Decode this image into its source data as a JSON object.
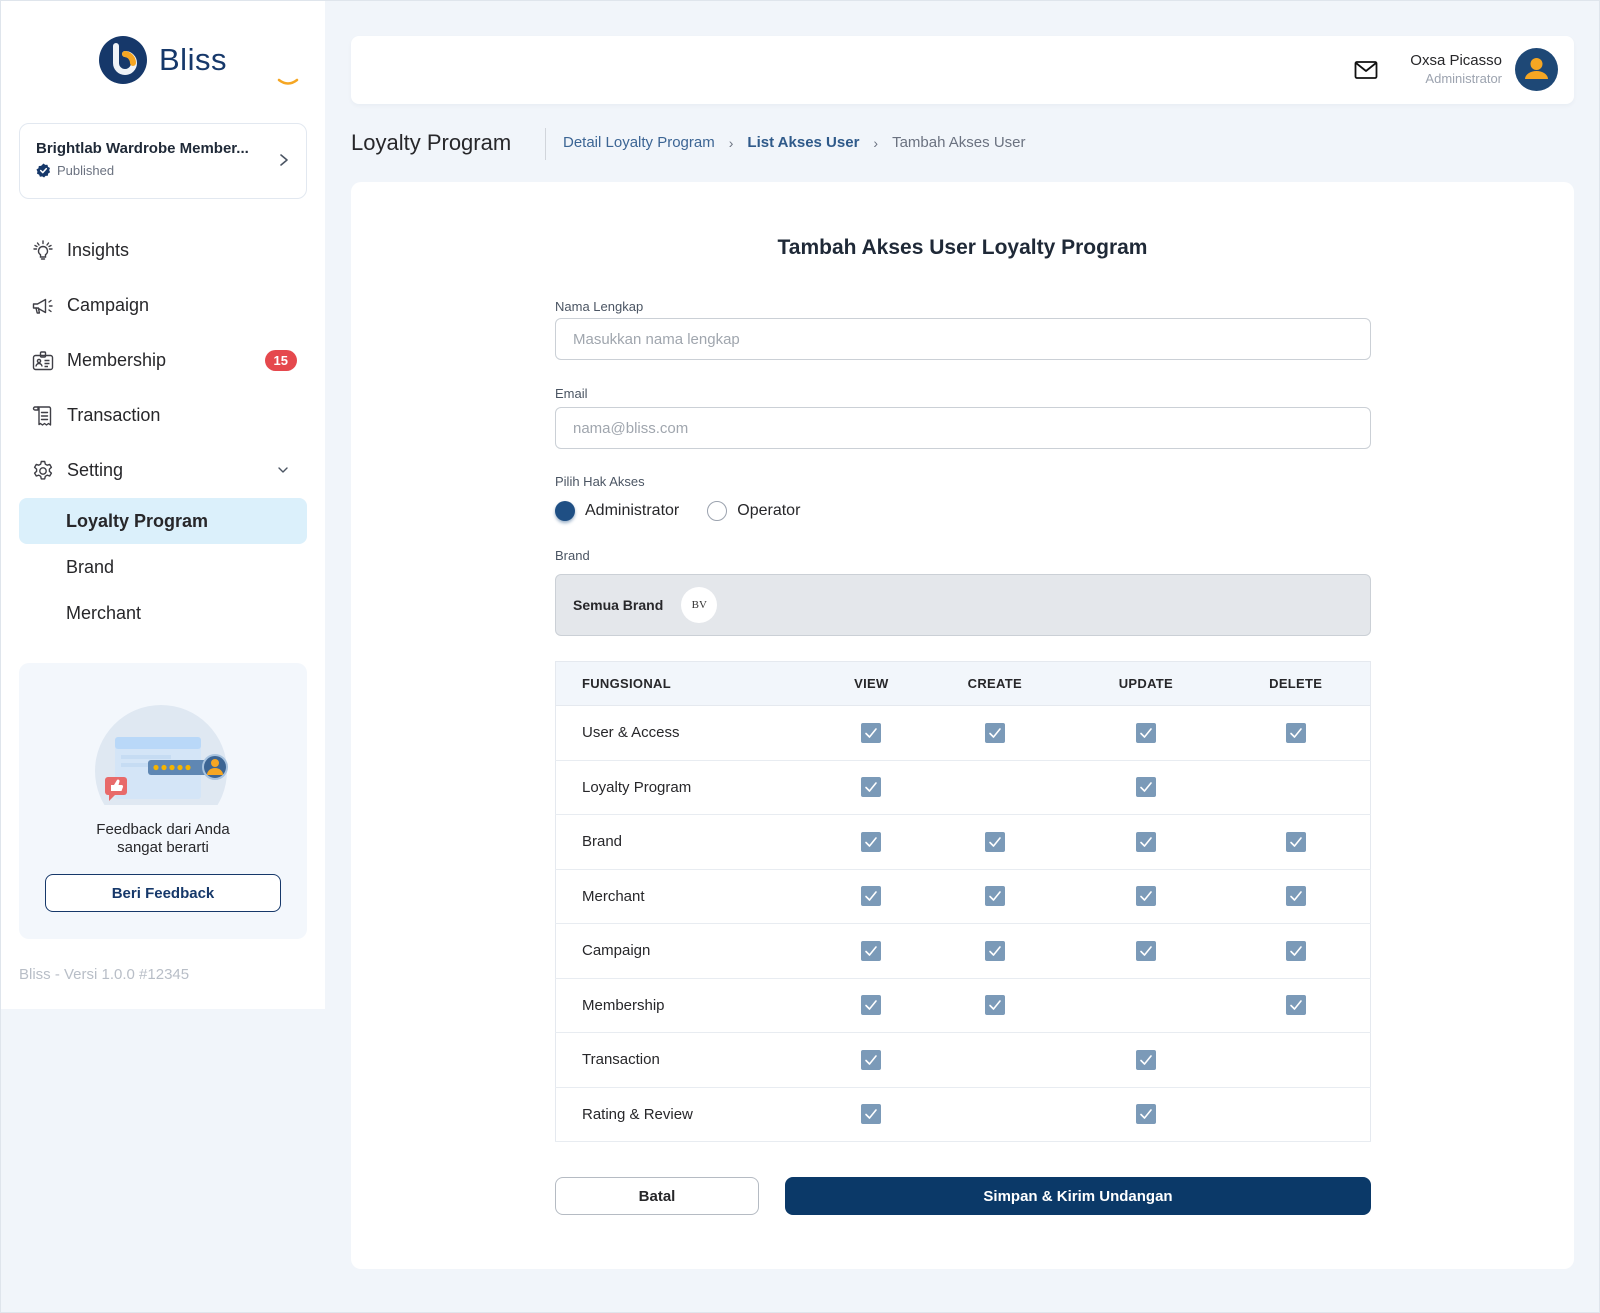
{
  "app": {
    "name": "Bliss"
  },
  "program_card": {
    "name": "Brightlab Wardrobe Member...",
    "status": "Published"
  },
  "sidebar": {
    "items": [
      {
        "label": "Insights",
        "icon": "lightbulb-icon"
      },
      {
        "label": "Campaign",
        "icon": "megaphone-icon"
      },
      {
        "label": "Membership",
        "icon": "id-badge-icon",
        "badge": "15"
      },
      {
        "label": "Transaction",
        "icon": "receipt-icon"
      },
      {
        "label": "Setting",
        "icon": "gear-icon",
        "expanded": true
      }
    ],
    "sub_items": [
      {
        "label": "Loyalty Program",
        "active": true
      },
      {
        "label": "Brand",
        "active": false
      },
      {
        "label": "Merchant",
        "active": false
      }
    ],
    "feedback": {
      "line1": "Feedback dari Anda",
      "line2": "sangat berarti",
      "button": "Beri Feedback"
    },
    "version": "Bliss - Versi 1.0.0 #12345"
  },
  "header": {
    "user_name": "Oxsa Picasso",
    "user_role": "Administrator"
  },
  "page": {
    "title": "Loyalty Program",
    "breadcrumb": [
      "Detail Loyalty Program",
      "List Akses User",
      "Tambah Akses User"
    ],
    "breadcrumb_sep": "›"
  },
  "form": {
    "title": "Tambah Akses User Loyalty Program",
    "name_label": "Nama Lengkap",
    "name_placeholder": "Masukkan nama lengkap",
    "name_value": "",
    "email_label": "Email",
    "email_placeholder": "nama@bliss.com",
    "email_value": "",
    "role_label": "Pilih Hak Akses",
    "roles": [
      {
        "label": "Administrator",
        "checked": true
      },
      {
        "label": "Operator",
        "checked": false
      }
    ],
    "brand_label": "Brand",
    "brand_value": "Semua Brand",
    "brand_chip": "BV",
    "table": {
      "headers": [
        "FUNGSIONAL",
        "VIEW",
        "CREATE",
        "UPDATE",
        "DELETE"
      ],
      "rows": [
        {
          "name": "User & Access",
          "view": true,
          "create": true,
          "update": true,
          "delete": true
        },
        {
          "name": "Loyalty Program",
          "view": true,
          "create": false,
          "update": true,
          "delete": false
        },
        {
          "name": "Brand",
          "view": true,
          "create": true,
          "update": true,
          "delete": true
        },
        {
          "name": "Merchant",
          "view": true,
          "create": true,
          "update": true,
          "delete": true
        },
        {
          "name": "Campaign",
          "view": true,
          "create": true,
          "update": true,
          "delete": true
        },
        {
          "name": "Membership",
          "view": true,
          "create": true,
          "update": false,
          "delete": true
        },
        {
          "name": "Transaction",
          "view": true,
          "create": false,
          "update": true,
          "delete": false
        },
        {
          "name": "Rating & Review",
          "view": true,
          "create": false,
          "update": true,
          "delete": false
        }
      ]
    },
    "cancel_label": "Batal",
    "submit_label": "Simpan & Kirim Undangan"
  },
  "colors": {
    "brand_primary": "#16386a",
    "accent_orange": "#f5a623",
    "badge_red": "#e5484d",
    "active_nav_bg": "#dbf0fb",
    "checkbox": "#7b9ab8",
    "submit_button": "#0b3968"
  }
}
